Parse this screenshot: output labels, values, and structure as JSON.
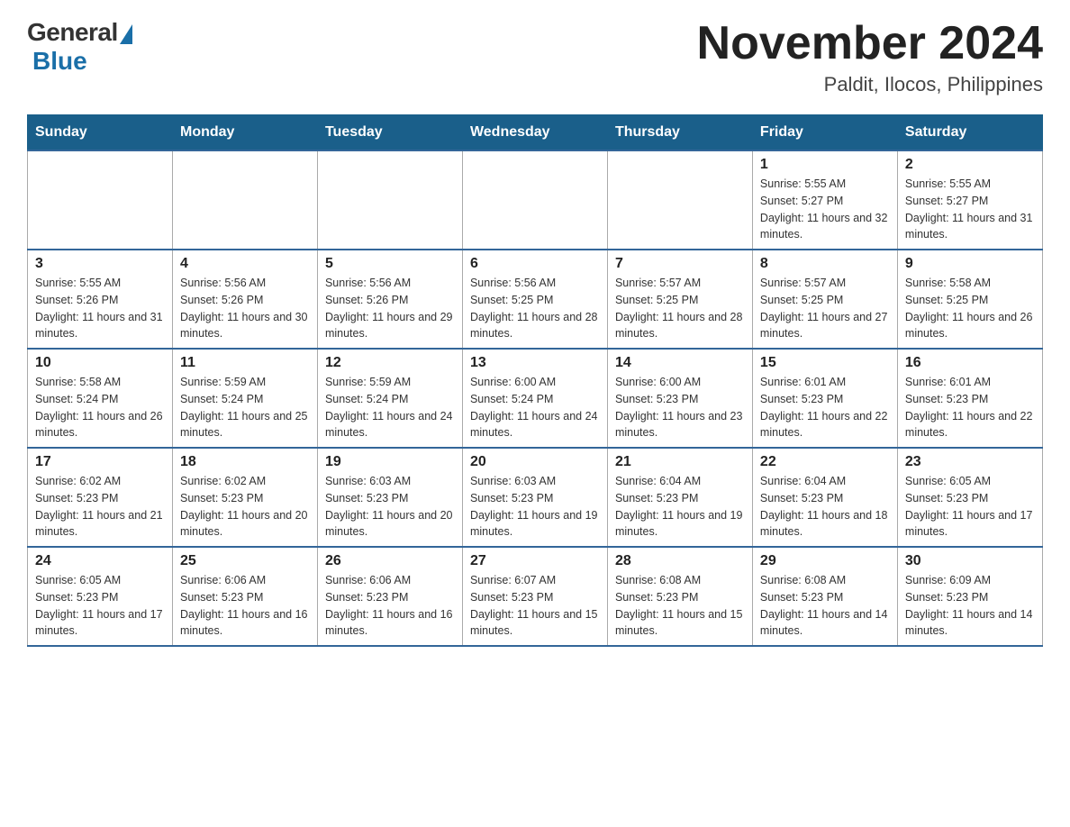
{
  "header": {
    "logo": {
      "general": "General",
      "blue": "Blue"
    },
    "title": "November 2024",
    "location": "Paldit, Ilocos, Philippines"
  },
  "days_of_week": [
    "Sunday",
    "Monday",
    "Tuesday",
    "Wednesday",
    "Thursday",
    "Friday",
    "Saturday"
  ],
  "weeks": [
    [
      {
        "day": "",
        "info": ""
      },
      {
        "day": "",
        "info": ""
      },
      {
        "day": "",
        "info": ""
      },
      {
        "day": "",
        "info": ""
      },
      {
        "day": "",
        "info": ""
      },
      {
        "day": "1",
        "info": "Sunrise: 5:55 AM\nSunset: 5:27 PM\nDaylight: 11 hours and 32 minutes."
      },
      {
        "day": "2",
        "info": "Sunrise: 5:55 AM\nSunset: 5:27 PM\nDaylight: 11 hours and 31 minutes."
      }
    ],
    [
      {
        "day": "3",
        "info": "Sunrise: 5:55 AM\nSunset: 5:26 PM\nDaylight: 11 hours and 31 minutes."
      },
      {
        "day": "4",
        "info": "Sunrise: 5:56 AM\nSunset: 5:26 PM\nDaylight: 11 hours and 30 minutes."
      },
      {
        "day": "5",
        "info": "Sunrise: 5:56 AM\nSunset: 5:26 PM\nDaylight: 11 hours and 29 minutes."
      },
      {
        "day": "6",
        "info": "Sunrise: 5:56 AM\nSunset: 5:25 PM\nDaylight: 11 hours and 28 minutes."
      },
      {
        "day": "7",
        "info": "Sunrise: 5:57 AM\nSunset: 5:25 PM\nDaylight: 11 hours and 28 minutes."
      },
      {
        "day": "8",
        "info": "Sunrise: 5:57 AM\nSunset: 5:25 PM\nDaylight: 11 hours and 27 minutes."
      },
      {
        "day": "9",
        "info": "Sunrise: 5:58 AM\nSunset: 5:25 PM\nDaylight: 11 hours and 26 minutes."
      }
    ],
    [
      {
        "day": "10",
        "info": "Sunrise: 5:58 AM\nSunset: 5:24 PM\nDaylight: 11 hours and 26 minutes."
      },
      {
        "day": "11",
        "info": "Sunrise: 5:59 AM\nSunset: 5:24 PM\nDaylight: 11 hours and 25 minutes."
      },
      {
        "day": "12",
        "info": "Sunrise: 5:59 AM\nSunset: 5:24 PM\nDaylight: 11 hours and 24 minutes."
      },
      {
        "day": "13",
        "info": "Sunrise: 6:00 AM\nSunset: 5:24 PM\nDaylight: 11 hours and 24 minutes."
      },
      {
        "day": "14",
        "info": "Sunrise: 6:00 AM\nSunset: 5:23 PM\nDaylight: 11 hours and 23 minutes."
      },
      {
        "day": "15",
        "info": "Sunrise: 6:01 AM\nSunset: 5:23 PM\nDaylight: 11 hours and 22 minutes."
      },
      {
        "day": "16",
        "info": "Sunrise: 6:01 AM\nSunset: 5:23 PM\nDaylight: 11 hours and 22 minutes."
      }
    ],
    [
      {
        "day": "17",
        "info": "Sunrise: 6:02 AM\nSunset: 5:23 PM\nDaylight: 11 hours and 21 minutes."
      },
      {
        "day": "18",
        "info": "Sunrise: 6:02 AM\nSunset: 5:23 PM\nDaylight: 11 hours and 20 minutes."
      },
      {
        "day": "19",
        "info": "Sunrise: 6:03 AM\nSunset: 5:23 PM\nDaylight: 11 hours and 20 minutes."
      },
      {
        "day": "20",
        "info": "Sunrise: 6:03 AM\nSunset: 5:23 PM\nDaylight: 11 hours and 19 minutes."
      },
      {
        "day": "21",
        "info": "Sunrise: 6:04 AM\nSunset: 5:23 PM\nDaylight: 11 hours and 19 minutes."
      },
      {
        "day": "22",
        "info": "Sunrise: 6:04 AM\nSunset: 5:23 PM\nDaylight: 11 hours and 18 minutes."
      },
      {
        "day": "23",
        "info": "Sunrise: 6:05 AM\nSunset: 5:23 PM\nDaylight: 11 hours and 17 minutes."
      }
    ],
    [
      {
        "day": "24",
        "info": "Sunrise: 6:05 AM\nSunset: 5:23 PM\nDaylight: 11 hours and 17 minutes."
      },
      {
        "day": "25",
        "info": "Sunrise: 6:06 AM\nSunset: 5:23 PM\nDaylight: 11 hours and 16 minutes."
      },
      {
        "day": "26",
        "info": "Sunrise: 6:06 AM\nSunset: 5:23 PM\nDaylight: 11 hours and 16 minutes."
      },
      {
        "day": "27",
        "info": "Sunrise: 6:07 AM\nSunset: 5:23 PM\nDaylight: 11 hours and 15 minutes."
      },
      {
        "day": "28",
        "info": "Sunrise: 6:08 AM\nSunset: 5:23 PM\nDaylight: 11 hours and 15 minutes."
      },
      {
        "day": "29",
        "info": "Sunrise: 6:08 AM\nSunset: 5:23 PM\nDaylight: 11 hours and 14 minutes."
      },
      {
        "day": "30",
        "info": "Sunrise: 6:09 AM\nSunset: 5:23 PM\nDaylight: 11 hours and 14 minutes."
      }
    ]
  ]
}
